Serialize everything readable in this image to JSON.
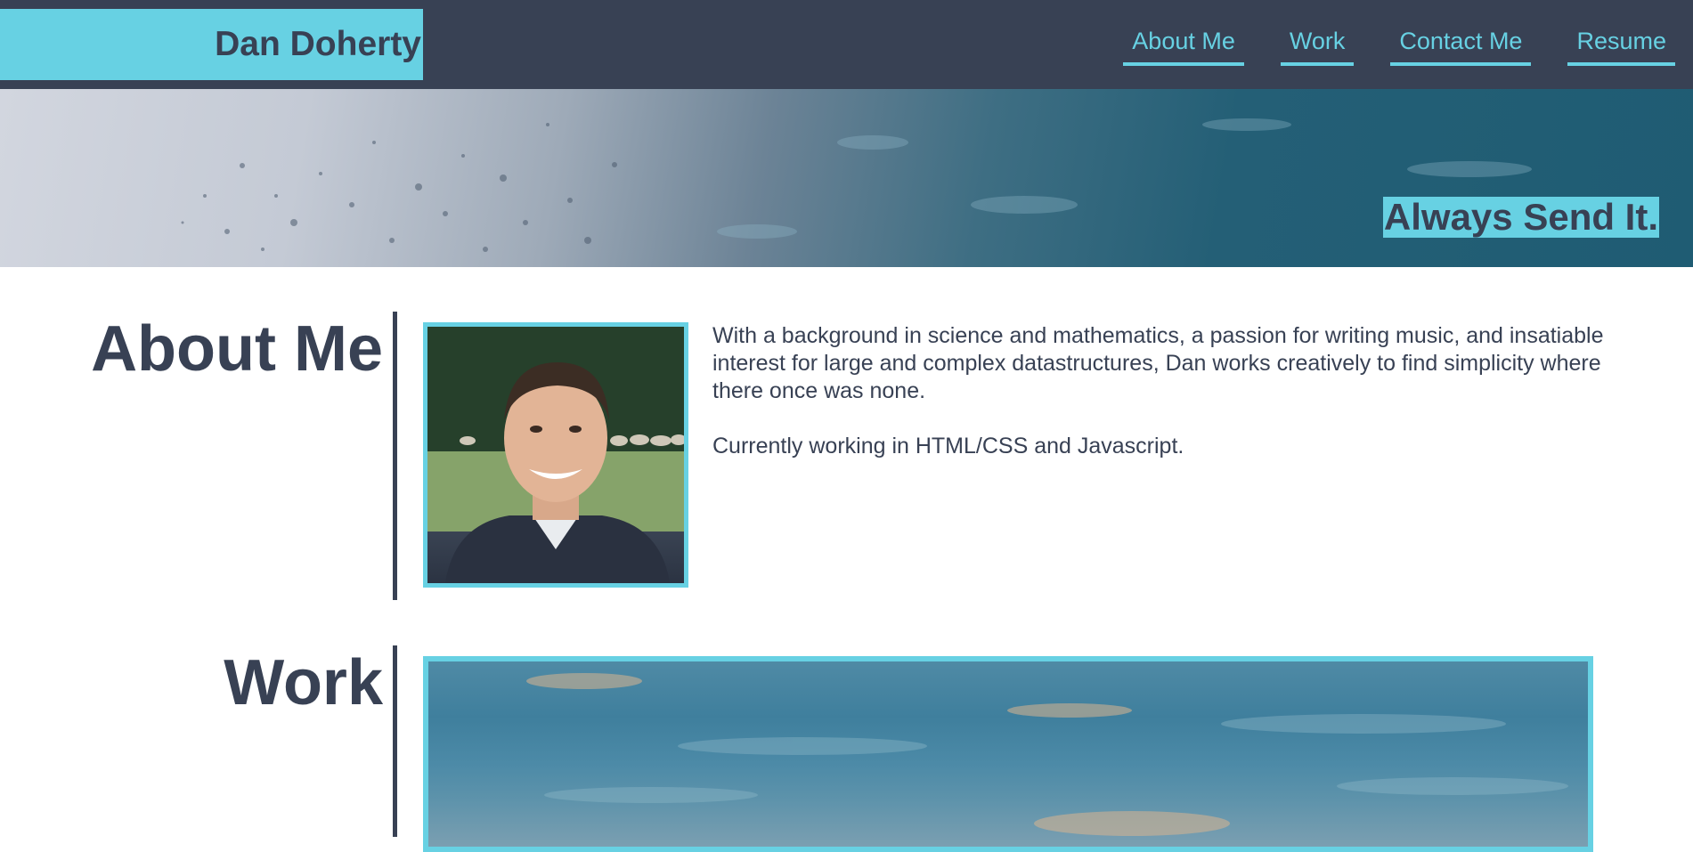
{
  "header": {
    "brand": "Dan Doherty",
    "nav": [
      "About Me",
      "Work",
      "Contact Me",
      "Resume"
    ]
  },
  "hero": {
    "tagline": "Always Send It."
  },
  "about": {
    "title": "About Me",
    "paragraphs": [
      "With a background in science and mathematics, a passion for writing music, and insatiable interest for large and complex datastructures, Dan works creatively to find simplicity where there once was none.",
      "Currently working in HTML/CSS and Javascript."
    ]
  },
  "work": {
    "title": "Work"
  },
  "colors": {
    "header_bg": "#384154",
    "accent": "#67d1e3",
    "text": "#384154"
  }
}
